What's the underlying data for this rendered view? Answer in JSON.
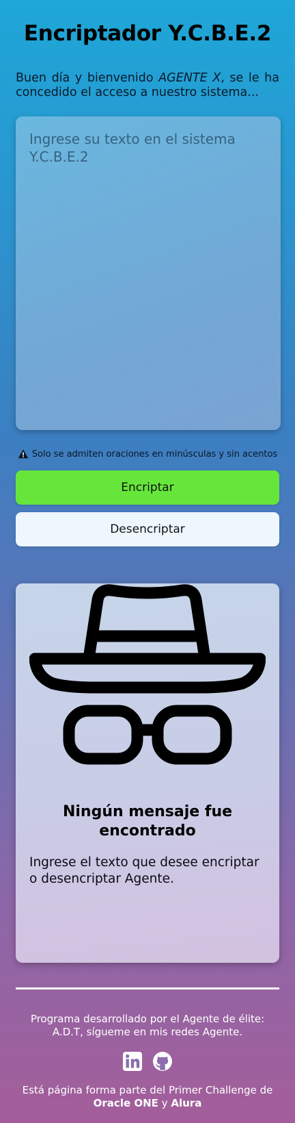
{
  "header": {
    "title": "Encriptador Y.C.B.E.2"
  },
  "intro": {
    "before_agent": "Buen día y bienvenido ",
    "agent_name": "AGENTE X",
    "after_agent": ", se le ha concedido el acceso a nuestro sistema..."
  },
  "input": {
    "value": "",
    "placeholder": "Ingrese su texto en el sistema Y.C.B.E.2"
  },
  "warning": {
    "icon": "warning-triangle-icon",
    "text": "Solo se admiten oraciones en minúsculas y sin acentos"
  },
  "buttons": {
    "encrypt_label": "Encriptar",
    "decrypt_label": "Desencriptar"
  },
  "result": {
    "icon": "incognito-spy-icon",
    "title": "Ningún mensaje fue encontrado",
    "text": "Ingrese el texto que desee encriptar o desencriptar Agente."
  },
  "footer": {
    "credit": "Programa desarrollado por el Agente de élite: A.D.T, sígueme en mis redes Agente.",
    "social": [
      {
        "icon": "linkedin-icon"
      },
      {
        "icon": "github-icon"
      }
    ],
    "challenge_prefix": "Está página forma parte del Primer Challenge de",
    "challenge_org1": "Oracle ONE",
    "challenge_join": "y",
    "challenge_org2": "Alura"
  },
  "colors": {
    "encrypt_button": "#66e63b",
    "decrypt_button": "#eef6fe",
    "background_top": "#1ea7d8",
    "background_bottom": "#a35e9a"
  }
}
